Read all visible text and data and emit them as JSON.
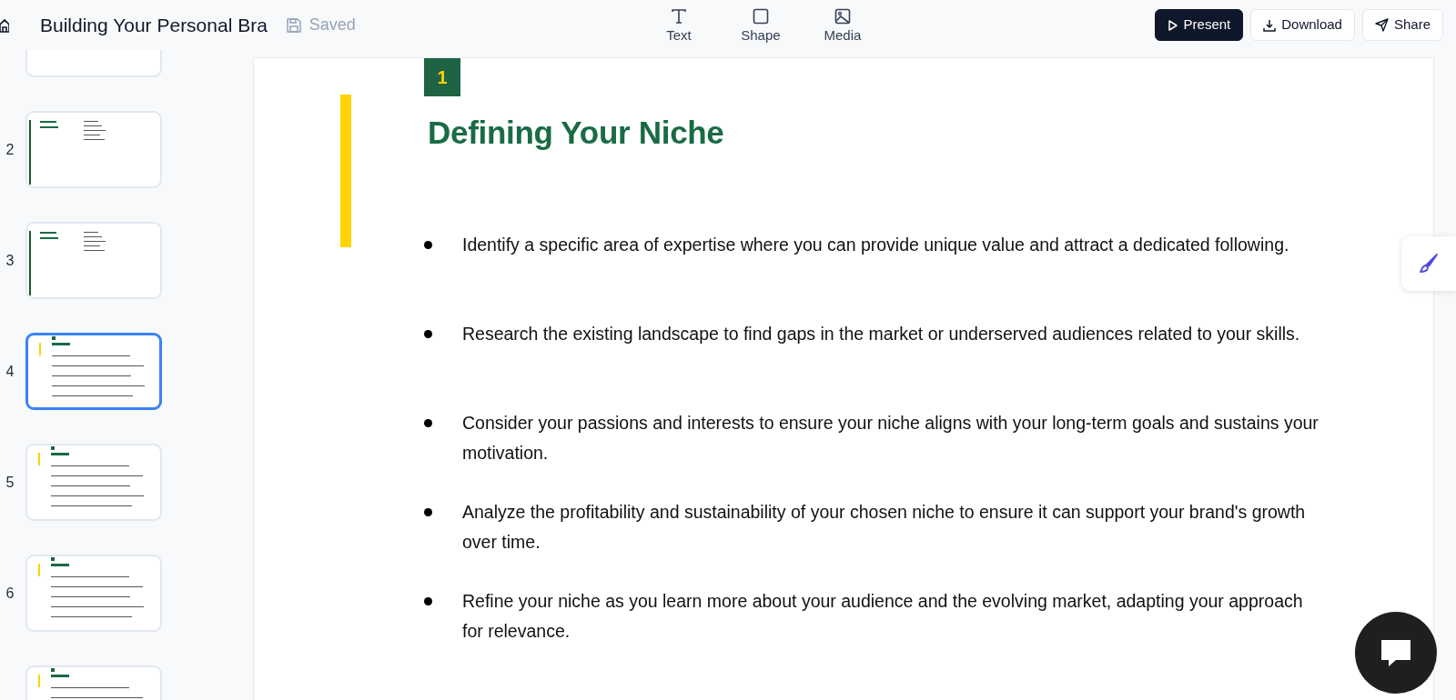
{
  "header": {
    "title": "Building Your Personal Bra",
    "save_status": "Saved"
  },
  "tools": [
    {
      "kind": "text",
      "label": "Text"
    },
    {
      "kind": "shape",
      "label": "Shape"
    },
    {
      "kind": "media",
      "label": "Media"
    }
  ],
  "actions": [
    {
      "kind": "present",
      "label": "Present",
      "primary": true
    },
    {
      "kind": "download",
      "label": "Download",
      "primary": false
    },
    {
      "kind": "share",
      "label": "Share",
      "primary": false
    }
  ],
  "thumbnails": [
    {
      "kind": "blank",
      "selected": false
    },
    {
      "kind": "toc",
      "number": "2",
      "selected": false
    },
    {
      "kind": "toc",
      "number": "3",
      "selected": false
    },
    {
      "kind": "content",
      "number": "4",
      "selected": true
    },
    {
      "kind": "content",
      "number": "5",
      "selected": false
    },
    {
      "kind": "content",
      "number": "6",
      "selected": false
    },
    {
      "kind": "content",
      "selected": false
    }
  ],
  "slide": {
    "number": "1",
    "title": "Defining Your Niche",
    "bullets": [
      "Identify a specific area of expertise where you can provide unique value and attract a dedicated following.",
      "Research the existing landscape to find gaps in the market or underserved audiences related to your skills.",
      "Consider your passions and interests to ensure your niche aligns with your long-term goals and sustains your motivation.",
      "Analyze the profitability and sustainability of your chosen niche to ensure it can support your brand's growth over time.",
      "Refine your niche as you learn more about your audience and the evolving market, adapting your approach for relevance."
    ]
  }
}
